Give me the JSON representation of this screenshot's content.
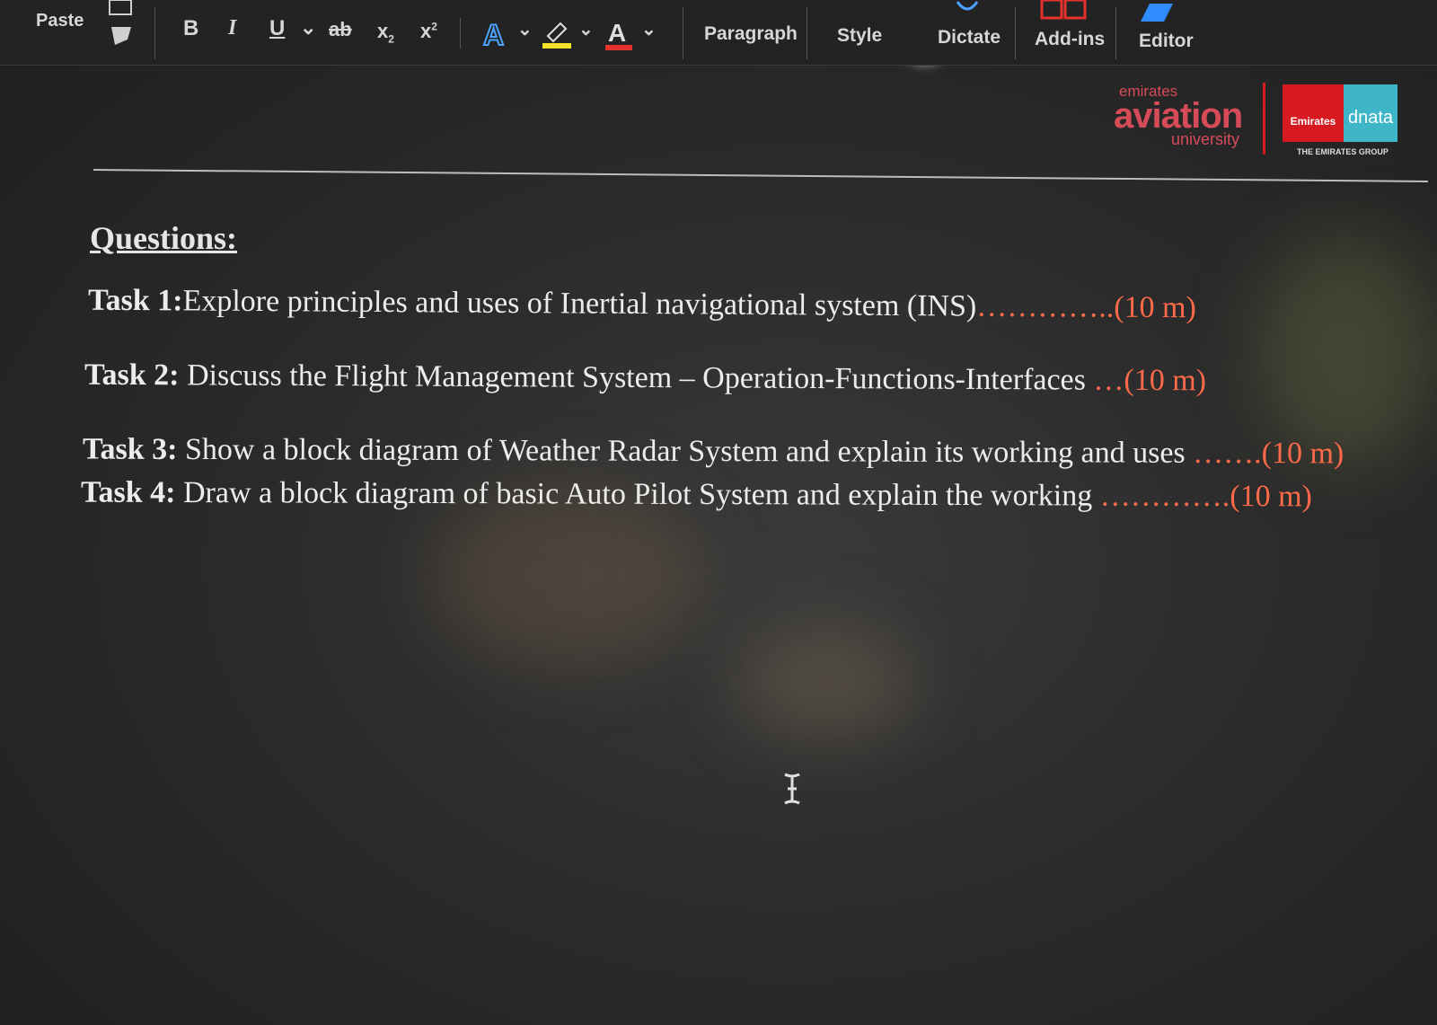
{
  "ribbon": {
    "paste": "Paste",
    "bold": "B",
    "italic": "I",
    "underline": "U",
    "strike": "ab",
    "subscript": "x",
    "subscript_mark": "2",
    "superscript": "x",
    "superscript_mark": "2",
    "paragraph": "Paragraph",
    "styles": "Style",
    "dictate": "Dictate",
    "addins": "Add-ins",
    "editor": "Editor",
    "dropdown": "⌄"
  },
  "logo": {
    "line1": "emirates",
    "line2": "aviation",
    "line3": "university",
    "emirates": "Emirates",
    "dnata": "dnata",
    "group": "THE EMIRATES GROUP"
  },
  "document": {
    "heading": "Questions:",
    "tasks": [
      {
        "label": "Task 1:",
        "text": "Explore principles and uses of Inertial navigational system (INS)",
        "dots": "…………..",
        "marks": "(10 m)"
      },
      {
        "label": "Task 2:",
        "text": " Discuss the Flight Management System – Operation-Functions-Interfaces ",
        "dots": " …",
        "marks": "(10 m)"
      },
      {
        "label": "Task 3:",
        "text": " Show a block diagram of Weather Radar System and explain its working and uses ",
        "dots": "…….",
        "marks": "(10 m)"
      },
      {
        "label": "Task 4:",
        "text": "  Draw a block diagram of basic Auto Pilot System and explain the working ",
        "dots": "………….",
        "marks": "(10 m)"
      }
    ]
  },
  "colors": {
    "accent_marks": "#ff6a4a",
    "emirates_red": "#d71a21",
    "dnata_teal": "#3fb6c8"
  }
}
